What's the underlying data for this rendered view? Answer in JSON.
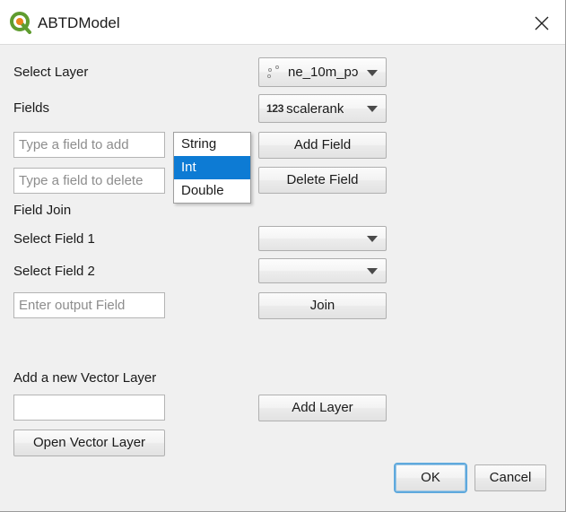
{
  "window": {
    "title": "ABTDModel",
    "app_icon": "qgis-logo-icon",
    "close_icon": "close-icon"
  },
  "form": {
    "select_layer_label": "Select Layer",
    "layer_combo": {
      "value": "ne_10m_pɔ",
      "icon": "point-layer-icon"
    },
    "fields_label": "Fields",
    "fields_combo": {
      "value": "scalerank",
      "icon": "numeric-field-icon",
      "icon_text": "123"
    },
    "add_field_input_placeholder": "Type a field to add",
    "add_field_input_value": "",
    "delete_field_input_placeholder": "Type a field to delete",
    "delete_field_input_value": "",
    "add_field_button": "Add Field",
    "delete_field_button": "Delete Field"
  },
  "type_popup": {
    "items": [
      {
        "label": "String",
        "selected": false
      },
      {
        "label": "Int",
        "selected": true
      },
      {
        "label": "Double",
        "selected": false
      }
    ],
    "highlight_color": "#0d7bd4"
  },
  "field_join": {
    "section_label": "Field Join",
    "select_field_1_label": "Select Field 1",
    "select_field_1_value": "",
    "select_field_2_label": "Select Field 2",
    "select_field_2_value": "",
    "output_field_placeholder": "Enter output Field",
    "output_field_value": "",
    "join_button": "Join"
  },
  "vector_layer": {
    "section_label": "Add a new Vector Layer",
    "path_input_placeholder": "",
    "path_input_value": "",
    "add_layer_button": "Add Layer",
    "open_vector_layer_button": "Open Vector Layer"
  },
  "dialog_buttons": {
    "ok_label": "OK",
    "cancel_label": "Cancel",
    "focus_color": "#5fa9dd"
  }
}
